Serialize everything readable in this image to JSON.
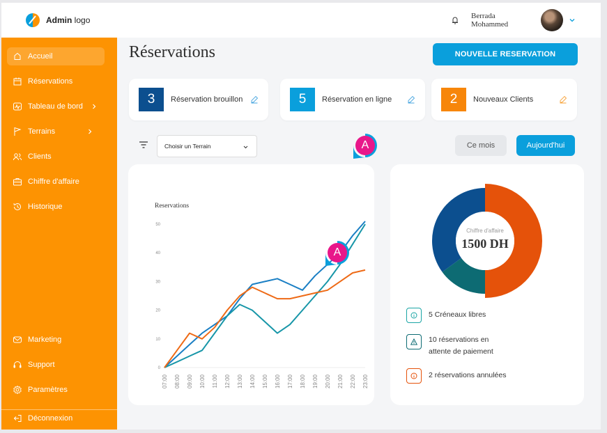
{
  "logo": {
    "bold": "Admin",
    "rest": " logo"
  },
  "user": {
    "name_line1": "Berrada",
    "name_line2": "Mohammed"
  },
  "sidebar": {
    "items": [
      {
        "label": "Accueil",
        "icon": "home-icon"
      },
      {
        "label": "Réservations",
        "icon": "calendar-icon"
      },
      {
        "label": "Tableau de bord",
        "icon": "dashboard-icon"
      },
      {
        "label": "Terrains",
        "icon": "flag-icon"
      },
      {
        "label": "Clients",
        "icon": "users-icon"
      },
      {
        "label": "Chiffre d'affaire",
        "icon": "briefcase-icon"
      },
      {
        "label": "Historique",
        "icon": "history-icon"
      }
    ],
    "bottom_items": [
      {
        "label": "Marketing",
        "icon": "mail-icon"
      },
      {
        "label": "Support",
        "icon": "headset-icon"
      },
      {
        "label": "Paramètres",
        "icon": "settings-icon"
      }
    ],
    "logout": {
      "label": "Déconnexion",
      "icon": "logout-icon"
    }
  },
  "main": {
    "title": "Réservations",
    "new_button": "NOUVELLE RESERVATION",
    "stats": [
      {
        "value": "3",
        "label": "Réservation brouillon",
        "color": "#0c4f8f"
      },
      {
        "value": "5",
        "label": "Réservation en ligne",
        "color": "#0a9fdc"
      },
      {
        "value": "2",
        "label": "Nouveaux Clients",
        "color": "#f7860a"
      }
    ],
    "filter": {
      "select_value": "Choisir un Terrain"
    },
    "period_buttons": {
      "month": "Ce mois",
      "today": "Aujourd'hui"
    },
    "markers": [
      "A",
      "A"
    ]
  },
  "donut": {
    "caption": "Chiffre d'affaire",
    "value": "1500 DH",
    "segments": [
      {
        "name": "orange",
        "fraction": 0.5,
        "color": "#e5520a"
      },
      {
        "name": "teal",
        "fraction": 0.15,
        "color": "#0d6b73"
      },
      {
        "name": "blue",
        "fraction": 0.35,
        "color": "#0c4f8f"
      }
    ],
    "legend": [
      {
        "text": "5 Créneaux libres",
        "color": "#1aa5a5",
        "icon": "info-icon"
      },
      {
        "text": "10 réservations en attente de paiement",
        "color": "#0d6b73",
        "icon": "warning-icon"
      },
      {
        "text": "2 réservations annulées",
        "color": "#e5520a",
        "icon": "info-icon"
      }
    ]
  },
  "chart_data": {
    "type": "line",
    "title": "Reservations",
    "categories": [
      "07:00",
      "08:00",
      "09:00",
      "10:00",
      "11:00",
      "12:00",
      "13:00",
      "14:00",
      "15:00",
      "16:00",
      "17:00",
      "18:00",
      "19:00",
      "20:00",
      "21:00",
      "22:00",
      "23:00"
    ],
    "yticks": [
      0,
      10,
      20,
      30,
      40,
      50
    ],
    "ylim": [
      0,
      50
    ],
    "series": [
      {
        "color": "#1a7fc4",
        "values": [
          0,
          4,
          8,
          12,
          15,
          18,
          24,
          29,
          30,
          31,
          29,
          27,
          32,
          36,
          40,
          46,
          51
        ]
      },
      {
        "color": "#1796a8",
        "values": [
          0,
          2,
          4,
          6,
          12,
          18,
          22,
          20,
          16,
          12,
          15,
          20,
          25,
          30,
          36,
          43,
          50
        ]
      },
      {
        "color": "#ee6a16",
        "values": [
          0,
          6,
          12,
          10,
          14,
          20,
          25,
          28,
          26,
          24,
          24,
          25,
          26,
          27,
          30,
          33,
          34
        ]
      }
    ]
  }
}
